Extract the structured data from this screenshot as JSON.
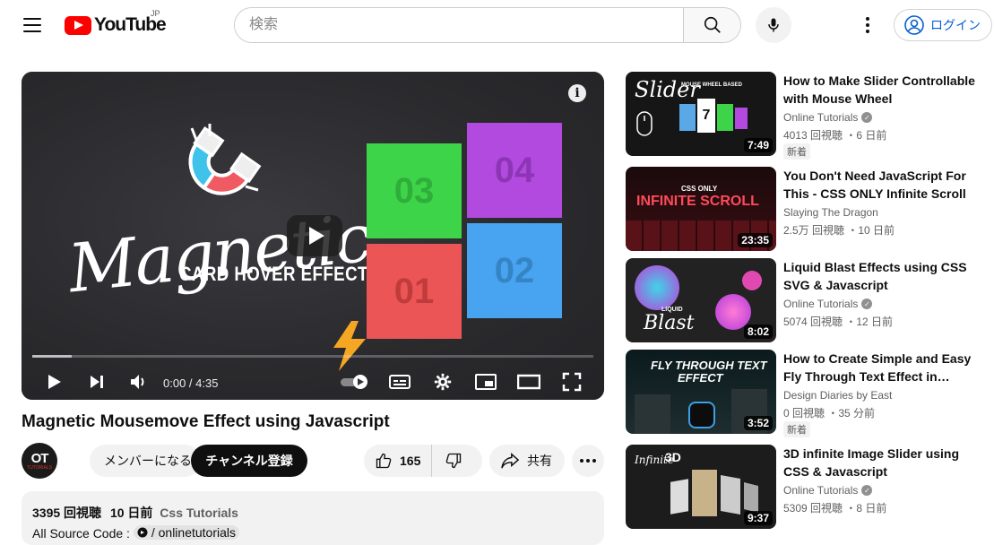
{
  "header": {
    "logo_text": "YouTube",
    "region": "JP",
    "search_placeholder": "検索",
    "login_label": "ログイン"
  },
  "player": {
    "thumb_title": "Magnetic",
    "thumb_subtitle": "CARD HOVER EFFECTS",
    "cards": [
      "03",
      "04",
      "01",
      "02"
    ],
    "time_display": "0:00 / 4:35",
    "progress": 0.07
  },
  "video": {
    "title": "Magnetic Mousemove Effect using Javascript",
    "avatar_text": "OT",
    "avatar_sub": "TUTORIALS",
    "member_label": "メンバーになる",
    "subscribe_label": "チャンネル登録",
    "likes": "165",
    "share_label": "共有",
    "views": "3395 回視聴",
    "date": "10 日前",
    "tag": "Css Tutorials",
    "source_label": "All Source Code :",
    "source_link": "/ onlinetutorials"
  },
  "related": [
    {
      "title": "How to Make Slider Controllable with Mouse Wheel",
      "channel": "Online Tutorials",
      "verified": true,
      "views": "4013 回視聴",
      "age": "6 日前",
      "badge": "新着",
      "duration": "7:49",
      "thumb_text": "Slider",
      "thumb_sub": "MOUSE WHEEL BASED"
    },
    {
      "title": "You Don't Need JavaScript For This - CSS ONLY Infinite Scroll",
      "channel": "Slaying The Dragon",
      "verified": false,
      "views": "2.5万 回視聴",
      "age": "10 日前",
      "badge": "",
      "duration": "23:35",
      "thumb_text": "INFINITE SCROLL",
      "thumb_sub": "CSS ONLY"
    },
    {
      "title": "Liquid Blast Effects using CSS SVG & Javascript",
      "channel": "Online Tutorials",
      "verified": true,
      "views": "5074 回視聴",
      "age": "12 日前",
      "badge": "",
      "duration": "8:02",
      "thumb_text": "Blast",
      "thumb_sub": "LIQUID"
    },
    {
      "title": "How to Create Simple and Easy Fly Through Text Effect in…",
      "channel": "Design Diaries by East",
      "verified": false,
      "views": "0 回視聴",
      "age": "35 分前",
      "badge": "新着",
      "duration": "3:52",
      "thumb_text": "FLY THROUGH TEXT",
      "thumb_sub": "EFFECT"
    },
    {
      "title": "3D infinite Image Slider using CSS & Javascript",
      "channel": "Online Tutorials",
      "verified": true,
      "views": "5309 回視聴",
      "age": "8 日前",
      "badge": "",
      "duration": "9:37",
      "thumb_text": "3D",
      "thumb_sub": "Infinite"
    }
  ]
}
